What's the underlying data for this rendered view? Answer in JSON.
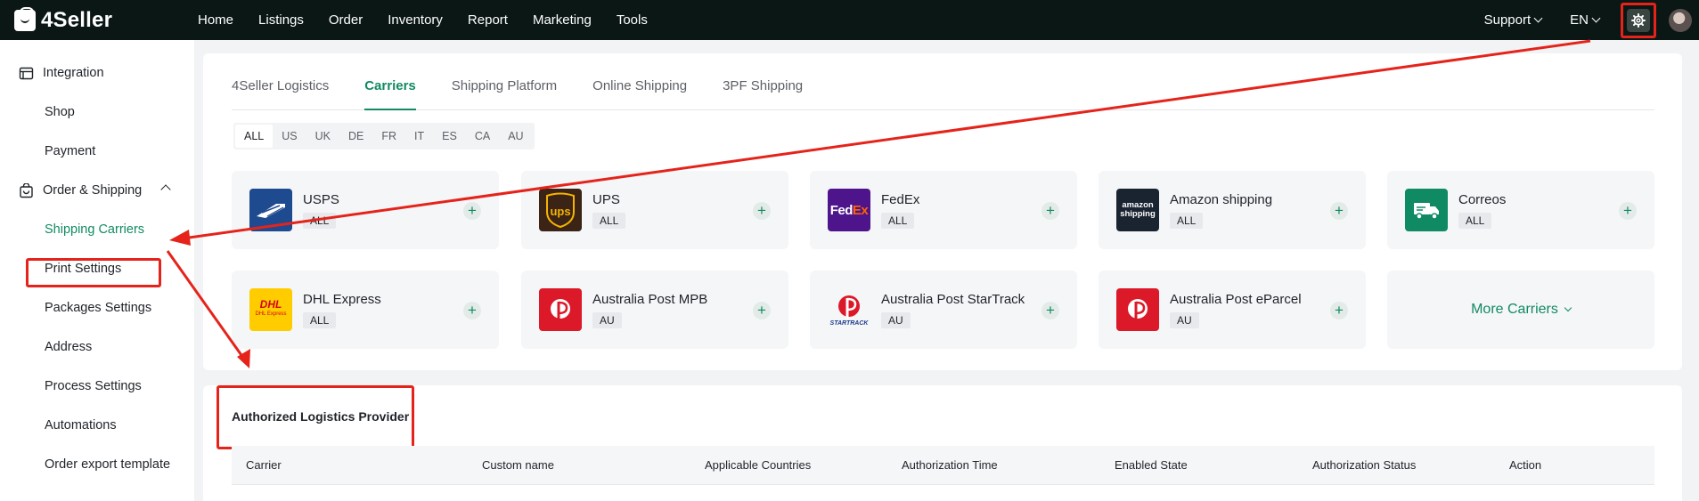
{
  "brand": {
    "name": "4Seller"
  },
  "nav": [
    "Home",
    "Listings",
    "Order",
    "Inventory",
    "Report",
    "Marketing",
    "Tools"
  ],
  "top_right": {
    "support": "Support",
    "lang": "EN"
  },
  "sidebar": {
    "integration": "Integration",
    "shop": "Shop",
    "payment": "Payment",
    "order_shipping": "Order & Shipping",
    "items": [
      "Shipping Carriers",
      "Print Settings",
      "Packages Settings",
      "Address",
      "Process Settings",
      "Automations",
      "Order export template"
    ]
  },
  "tabs": [
    "4Seller Logistics",
    "Carriers",
    "Shipping Platform",
    "Online Shipping",
    "3PF Shipping"
  ],
  "active_tab": "Carriers",
  "regions": [
    "ALL",
    "US",
    "UK",
    "DE",
    "FR",
    "IT",
    "ES",
    "CA",
    "AU"
  ],
  "carriers": [
    {
      "name": "USPS",
      "tag": "ALL"
    },
    {
      "name": "UPS",
      "tag": "ALL"
    },
    {
      "name": "FedEx",
      "tag": "ALL"
    },
    {
      "name": "Amazon shipping",
      "tag": "ALL"
    },
    {
      "name": "Correos",
      "tag": "ALL"
    },
    {
      "name": "DHL Express",
      "tag": "ALL"
    },
    {
      "name": "Australia Post MPB",
      "tag": "AU"
    },
    {
      "name": "Australia Post StarTrack",
      "tag": "AU"
    },
    {
      "name": "Australia Post eParcel",
      "tag": "AU"
    }
  ],
  "logo_marks": {
    "ups": "ups",
    "fedex_a": "Fed",
    "fedex_b": "Ex",
    "amazon_a": "amazon",
    "amazon_b": "shipping",
    "dhl_a": "DHL",
    "dhl_b": "DHL Express",
    "startrack": "STARTRACK"
  },
  "more_carriers": "More Carriers",
  "authorized": {
    "title": "Authorized Logistics Provider",
    "columns": [
      "Carrier",
      "Custom name",
      "Applicable Countries",
      "Authorization Time",
      "Enabled State",
      "Authorization Status",
      "Action"
    ]
  },
  "colors": {
    "accent": "#118a64",
    "highlight": "#e5231b",
    "topbar": "#0a1714"
  }
}
